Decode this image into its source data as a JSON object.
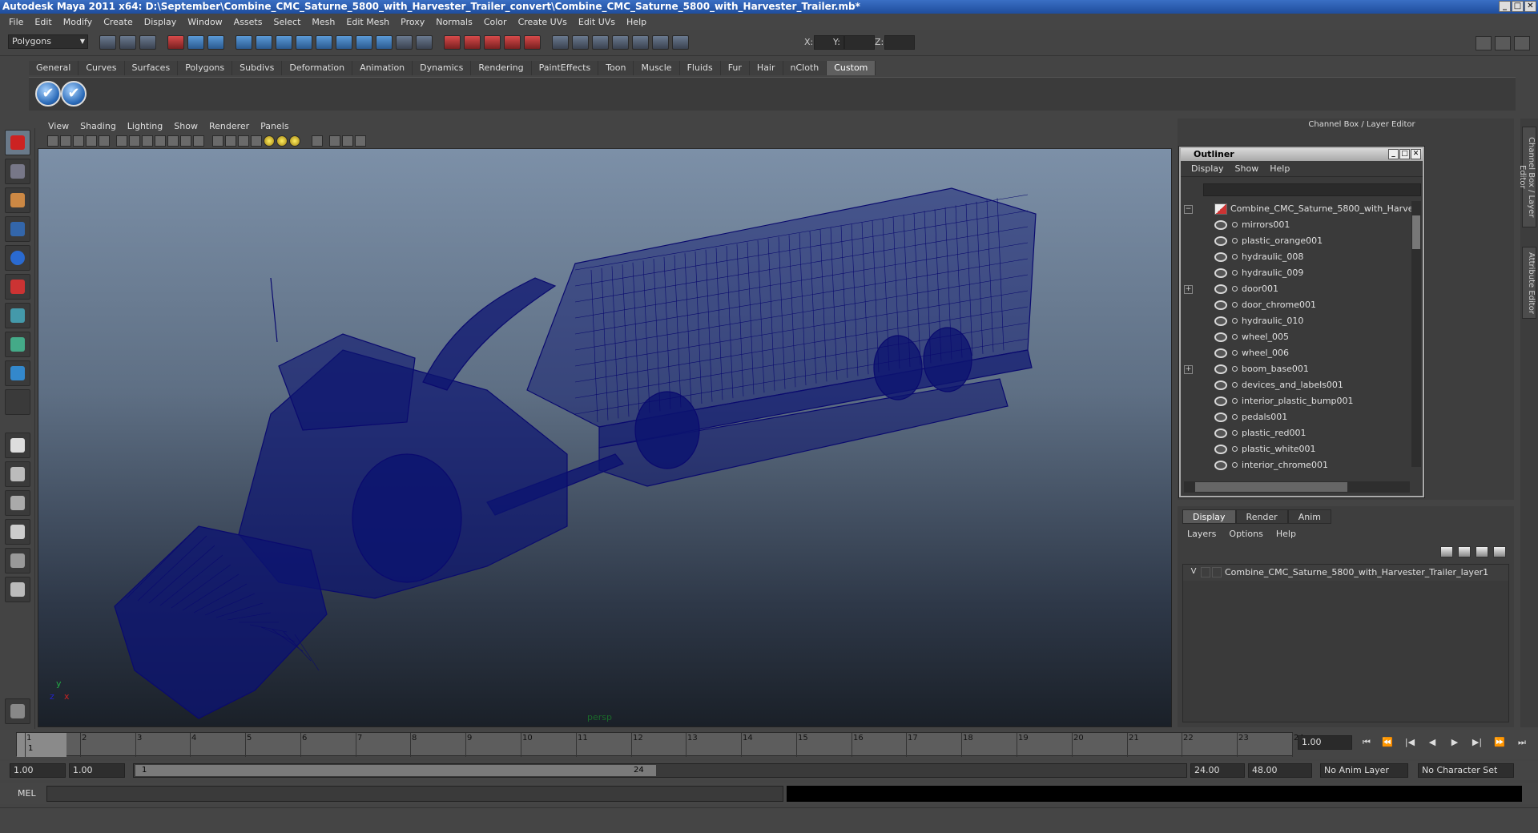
{
  "window": {
    "title": "Autodesk Maya 2011 x64: D:\\September\\Combine_CMC_Saturne_5800_with_Harvester_Trailer_convert\\Combine_CMC_Saturne_5800_with_Harvester_Trailer.mb*",
    "controls": [
      "_",
      "□",
      "✕"
    ]
  },
  "menubar": [
    "File",
    "Edit",
    "Modify",
    "Create",
    "Display",
    "Window",
    "Assets",
    "Select",
    "Mesh",
    "Edit Mesh",
    "Proxy",
    "Normals",
    "Color",
    "Create UVs",
    "Edit UVs",
    "Help"
  ],
  "statusline": {
    "mode": "Polygons",
    "x_label": "X:",
    "y_label": "Y:",
    "z_label": "Z:"
  },
  "shelf": {
    "tabs": [
      "General",
      "Curves",
      "Surfaces",
      "Polygons",
      "Subdivs",
      "Deformation",
      "Animation",
      "Dynamics",
      "Rendering",
      "PaintEffects",
      "Toon",
      "Muscle",
      "Fluids",
      "Fur",
      "Hair",
      "nCloth",
      "Custom"
    ],
    "active_tab": "Custom",
    "check_glyph": "✔"
  },
  "viewport": {
    "menu": [
      "View",
      "Shading",
      "Lighting",
      "Show",
      "Renderer",
      "Panels"
    ],
    "camera_label": "persp",
    "axis_y": "y",
    "axis_x": "x",
    "axis_z": "z",
    "wire_color": "#0a0a6e"
  },
  "channel_box": {
    "title": "Channel Box / Layer Editor"
  },
  "outliner": {
    "title": "Outliner",
    "menu": [
      "Display",
      "Show",
      "Help"
    ],
    "root": "Combine_CMC_Saturne_5800_with_Harves",
    "items": [
      {
        "name": "mirrors001",
        "expandable": false
      },
      {
        "name": "plastic_orange001",
        "expandable": false
      },
      {
        "name": "hydraulic_008",
        "expandable": false
      },
      {
        "name": "hydraulic_009",
        "expandable": false
      },
      {
        "name": "door001",
        "expandable": true
      },
      {
        "name": "door_chrome001",
        "expandable": false
      },
      {
        "name": "hydraulic_010",
        "expandable": false
      },
      {
        "name": "wheel_005",
        "expandable": false
      },
      {
        "name": "wheel_006",
        "expandable": false
      },
      {
        "name": "boom_base001",
        "expandable": true
      },
      {
        "name": "devices_and_labels001",
        "expandable": false
      },
      {
        "name": "interior_plastic_bump001",
        "expandable": false
      },
      {
        "name": "pedals001",
        "expandable": false
      },
      {
        "name": "plastic_red001",
        "expandable": false
      },
      {
        "name": "plastic_white001",
        "expandable": false
      },
      {
        "name": "interior_chrome001",
        "expandable": false
      }
    ],
    "expand_glyph": "+",
    "collapse_glyph": "−"
  },
  "layer_editor": {
    "tabs": [
      "Display",
      "Render",
      "Anim"
    ],
    "active_tab": "Display",
    "menu": [
      "Layers",
      "Options",
      "Help"
    ],
    "layer": {
      "visible": "V",
      "name": "Combine_CMC_Saturne_5800_with_Harvester_Trailer_layer1"
    }
  },
  "side_tabs": [
    "Channel Box / Layer Editor",
    "Attribute Editor"
  ],
  "timeslider": {
    "ticks": [
      1,
      2,
      3,
      4,
      5,
      6,
      7,
      8,
      9,
      10,
      11,
      12,
      13,
      14,
      15,
      16,
      17,
      18,
      19,
      20,
      21,
      22,
      23,
      24
    ],
    "current_frame": "1",
    "current_frame_field": "1.00",
    "playback_glyphs": [
      "⏮",
      "⏪",
      "|◀",
      "◀",
      "▶",
      "▶|",
      "⏩",
      "⏭"
    ]
  },
  "rangebar": {
    "start": "1.00",
    "playback_start": "1.00",
    "slider_start": "1",
    "slider_end": "24",
    "playback_end": "24.00",
    "end": "48.00",
    "anim_layer": "No Anim Layer",
    "character_set": "No Character Set"
  },
  "commandline": {
    "label": "MEL"
  }
}
